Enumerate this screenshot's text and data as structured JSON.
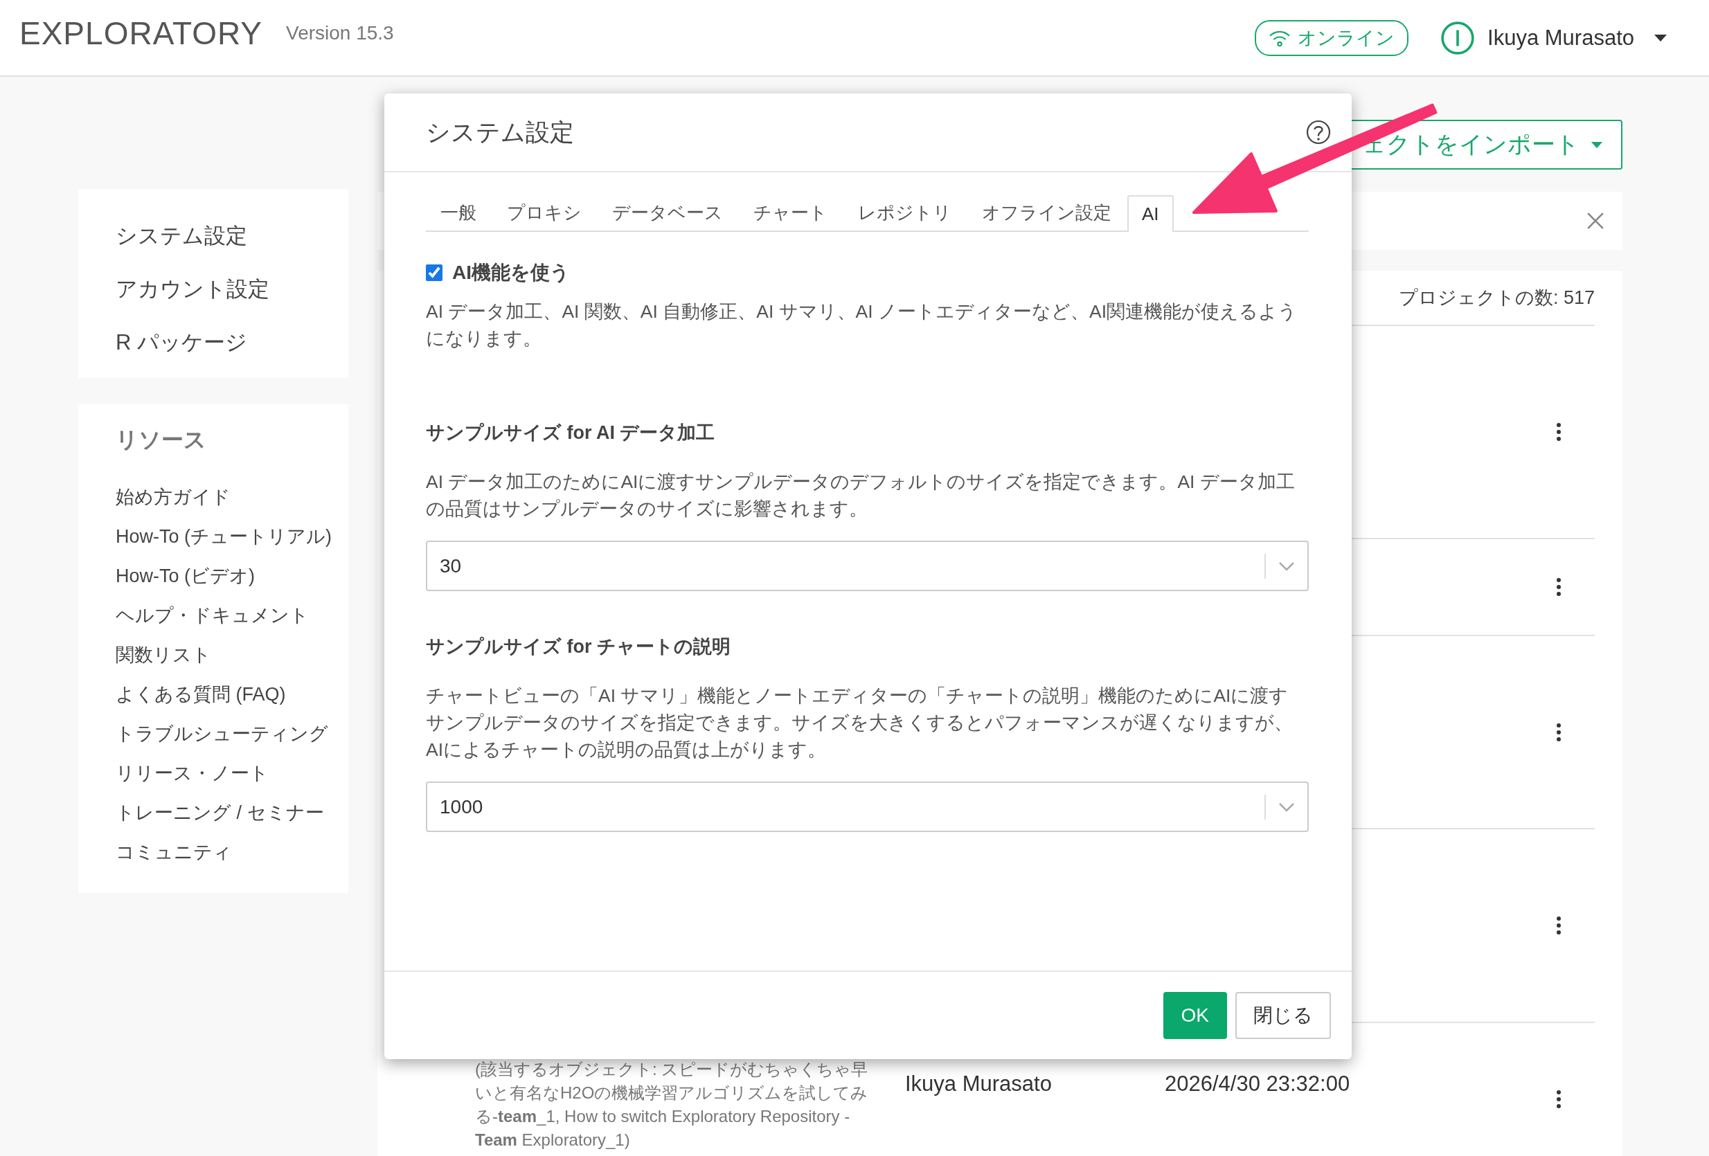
{
  "header": {
    "logo": "EXPLORATORY",
    "version": "Version 15.3",
    "status": {
      "label": "オンライン",
      "online": true
    },
    "user": {
      "name": "Ikuya Murasato"
    }
  },
  "sidebar": {
    "settings_items": [
      "システム設定",
      "アカウント設定",
      "R パッケージ"
    ],
    "resources": {
      "title": "リソース",
      "items": [
        "始め方ガイド",
        "How-To (チュートリアル)",
        "How-To (ビデオ)",
        "ヘルプ・ドキュメント",
        "関数リスト",
        "よくある質問 (FAQ)",
        "トラブルシューティング",
        "リリース・ノート",
        "トレーニング / セミナー",
        "コミュニティ"
      ]
    }
  },
  "main": {
    "import_button": "ェクトをインポート",
    "project_count": "プロジェクトの数: 517",
    "rows": [
      {
        "kind": "covered"
      },
      {
        "kind": "covered"
      },
      {
        "kind": "covered"
      },
      {
        "kind": "covered"
      },
      {
        "kind": "project",
        "description": "(該当するオブジェクト: スピードがむちゃくちゃ早いと有名なH2Oの機械学習アルゴリズムを試してみる-**team**_1, How to switch Exploratory Repository - **Team** Exploratory_1)",
        "author": "Ikuya Murasato",
        "date": "2026/4/30 23:32:00"
      }
    ]
  },
  "dialog": {
    "title": "システム設定",
    "tabs": [
      {
        "label": "一般",
        "selected": false
      },
      {
        "label": "プロキシ",
        "selected": false
      },
      {
        "label": "データベース",
        "selected": false
      },
      {
        "label": "チャート",
        "selected": false
      },
      {
        "label": "レポジトリ",
        "selected": false
      },
      {
        "label": "オフライン設定",
        "selected": false
      },
      {
        "label": "AI",
        "selected": true
      }
    ],
    "ai_enabled": {
      "label": "AI機能を使う",
      "checked": true
    },
    "description": "AI データ加工、AI 関数、AI 自動修正、AI サマリ、AI ノートエディターなど、AI関連機能が使えるようになります。",
    "sections": [
      {
        "heading": "サンプルサイズ for AI データ加工",
        "description": "AI データ加工のためにAIに渡すサンプルデータのデフォルトのサイズを指定できます。AI データ加工の品質はサンプルデータのサイズに影響されます。",
        "value": "30"
      },
      {
        "heading": "サンプルサイズ for チャートの説明",
        "description": "チャートビューの「AI サマリ」機能とノートエディターの「チャートの説明」機能のためにAIに渡すサンプルデータのサイズを指定できます。サイズを大きくするとパフォーマンスが遅くなりますが、AIによるチャートの説明の品質は上がります。",
        "value": "1000"
      }
    ],
    "buttons": [
      {
        "label": "OK",
        "kind": "primary"
      },
      {
        "label": "閉じる",
        "kind": "default"
      }
    ]
  }
}
